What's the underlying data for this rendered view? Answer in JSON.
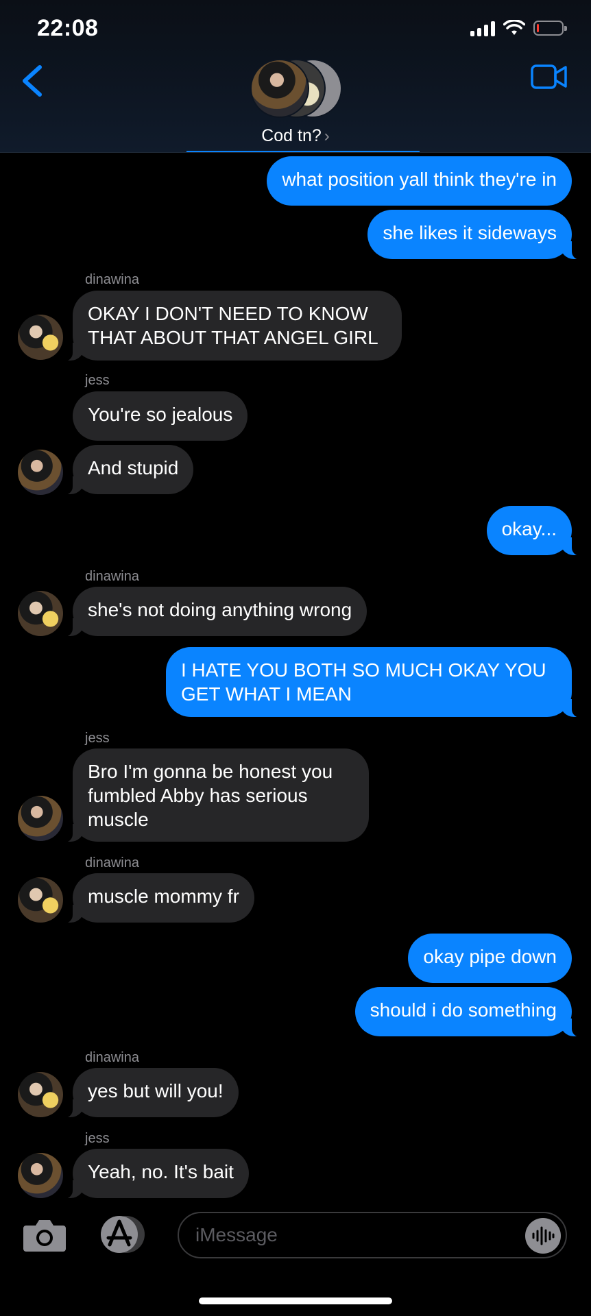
{
  "status_bar": {
    "time": "22:08",
    "battery_percent": 8
  },
  "header": {
    "group_name": "Cod tn?",
    "chevron": "›"
  },
  "messages": [
    {
      "direction": "sent",
      "text": "what position yall think they're in"
    },
    {
      "direction": "sent",
      "text": "she likes it sideways"
    },
    {
      "direction": "received",
      "sender": "dinawina",
      "text": "OKAY I DON'T NEED TO KNOW THAT ABOUT THAT ANGEL GIRL"
    },
    {
      "direction": "received",
      "sender": "jess",
      "text": "You're so jealous"
    },
    {
      "direction": "received",
      "text": "And stupid"
    },
    {
      "direction": "sent",
      "text": "okay..."
    },
    {
      "direction": "received",
      "sender": "dinawina",
      "text": "she's not doing anything wrong"
    },
    {
      "direction": "sent",
      "text": "I HATE YOU BOTH SO MUCH OKAY YOU GET WHAT I MEAN"
    },
    {
      "direction": "received",
      "sender": "jess",
      "text": "Bro I'm gonna be honest you fumbled Abby has serious muscle"
    },
    {
      "direction": "received",
      "sender": "dinawina",
      "text": "muscle mommy fr"
    },
    {
      "direction": "sent",
      "text": "okay pipe down"
    },
    {
      "direction": "sent",
      "text": "should i do something"
    },
    {
      "direction": "received",
      "sender": "dinawina",
      "text": "yes but will you!"
    },
    {
      "direction": "received",
      "sender": "jess",
      "text": "Yeah, no. It's bait"
    }
  ],
  "composer": {
    "placeholder": "iMessage"
  },
  "icons": {
    "back": "chevron-left-icon",
    "video": "video-camera-icon",
    "camera": "camera-icon",
    "apps": "app-store-icon",
    "audio": "waveform-icon"
  },
  "colors": {
    "sent_bubble": "#0a84ff",
    "received_bubble": "#262628",
    "accent": "#0a84ff",
    "background": "#000000"
  }
}
